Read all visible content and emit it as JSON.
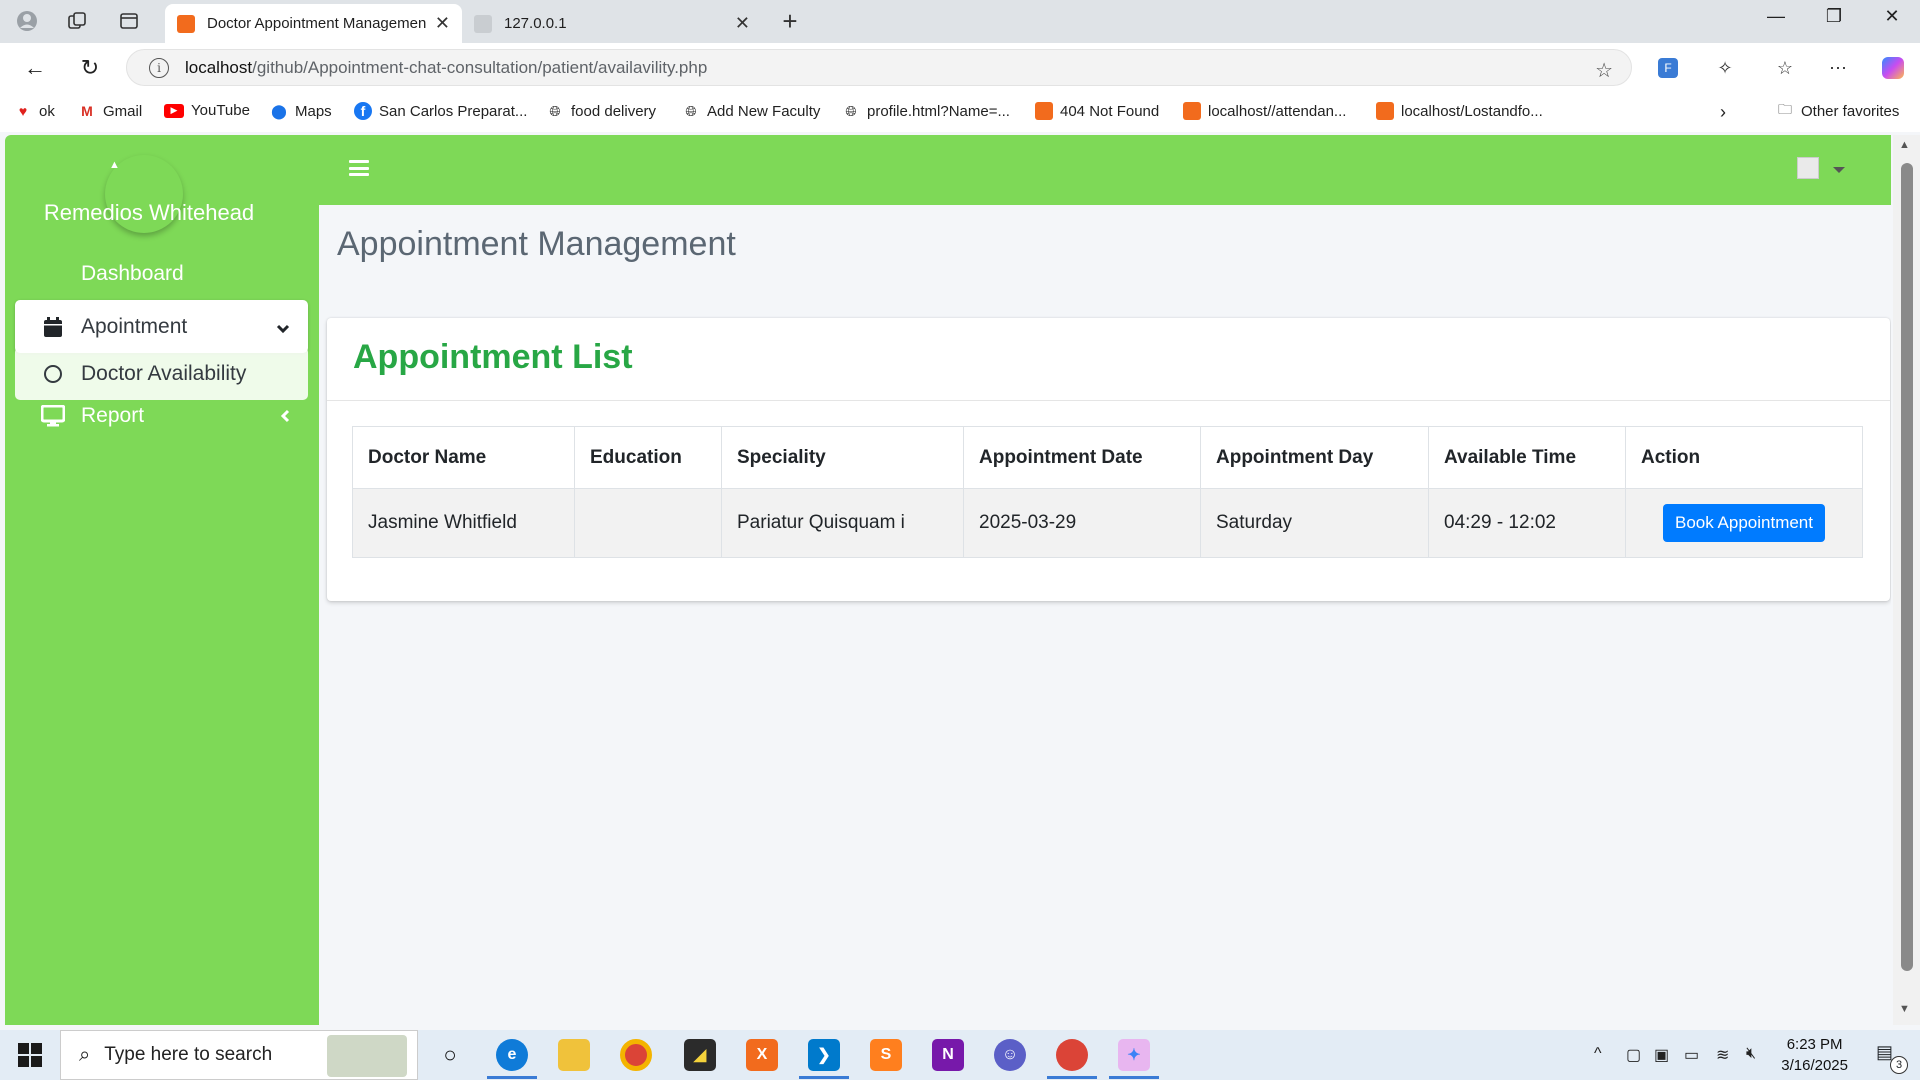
{
  "browser": {
    "tabs": [
      {
        "title": "Doctor Appointment Managemen",
        "active": true
      },
      {
        "title": "127.0.0.1",
        "active": false
      }
    ],
    "url_host": "localhost",
    "url_path": "/github/Appointment-chat-consultation/patient/availavility.php",
    "bookmarks": [
      {
        "label": "ok",
        "icon": "heart-icon"
      },
      {
        "label": "Gmail",
        "icon": "gmail-icon"
      },
      {
        "label": "YouTube",
        "icon": "youtube-icon"
      },
      {
        "label": "Maps",
        "icon": "maps-icon"
      },
      {
        "label": "San Carlos Preparat...",
        "icon": "facebook-icon"
      },
      {
        "label": "food delivery",
        "icon": "globe-icon"
      },
      {
        "label": "Add New Faculty",
        "icon": "globe-icon"
      },
      {
        "label": "profile.html?Name=...",
        "icon": "globe-icon"
      },
      {
        "label": "404 Not Found",
        "icon": "xampp-icon"
      },
      {
        "label": "localhost//attendan...",
        "icon": "xampp-icon"
      },
      {
        "label": "localhost/Lostandfo...",
        "icon": "xampp-icon"
      }
    ],
    "other_favorites": "Other favorites"
  },
  "sidebar": {
    "user_name": "Remedios Whitehead",
    "items": [
      {
        "label": "Dashboard"
      },
      {
        "label": "Apointment"
      },
      {
        "label": "Doctor Availability"
      },
      {
        "label": "Report"
      }
    ]
  },
  "page": {
    "title": "Appointment Management",
    "card_title": "Appointment List"
  },
  "table": {
    "headers": [
      "Doctor Name",
      "Education",
      "Speciality",
      "Appointment Date",
      "Appointment Day",
      "Available Time",
      "Action"
    ],
    "rows": [
      {
        "doctor": "Jasmine Whitfield",
        "education": "",
        "speciality": "Pariatur Quisquam i",
        "date": "2025-03-29",
        "day": "Saturday",
        "time": "04:29 - 12:02",
        "action": "Book Appointment"
      }
    ]
  },
  "taskbar": {
    "search_placeholder": "Type here to search",
    "time": "6:23 PM",
    "date": "3/16/2025",
    "notification_count": "3"
  },
  "colors": {
    "accent_green": "#7ed957",
    "title_green": "#28a745",
    "button_blue": "#007bff"
  }
}
